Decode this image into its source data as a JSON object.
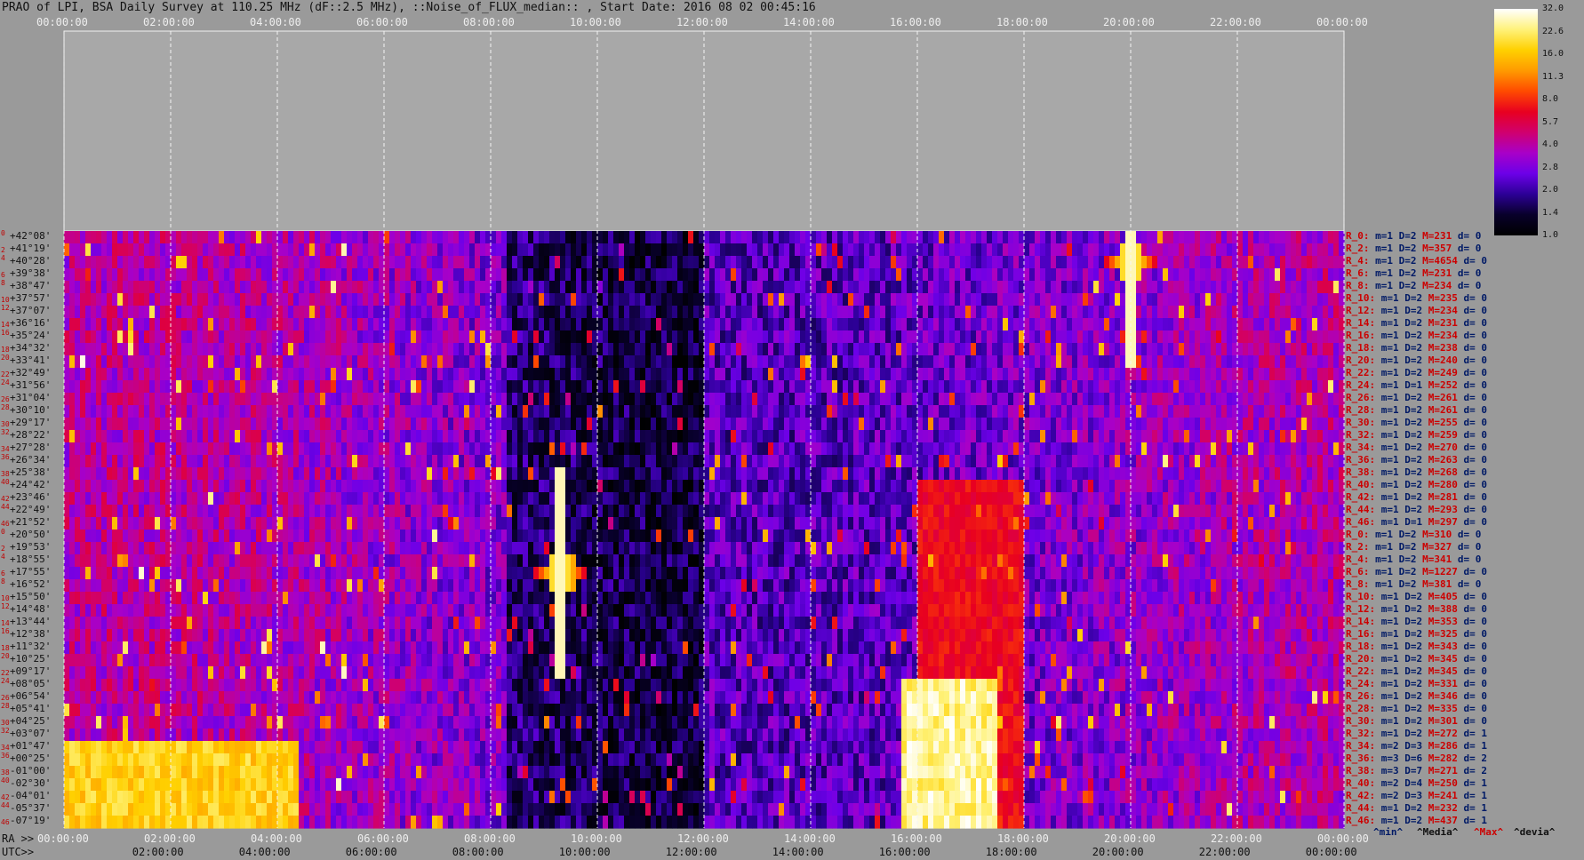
{
  "title": "PRAO of LPI, BSA Daily Survey at 110.25 MHz (dF::2.5 MHz), ::Noise_of_FLUX_median:: , Start Date: 2016 08 02 00:45:16",
  "top_axis_ticks": [
    "00:00:00",
    "02:00:00",
    "04:00:00",
    "06:00:00",
    "08:00:00",
    "10:00:00",
    "12:00:00",
    "14:00:00",
    "16:00:00",
    "18:00:00",
    "20:00:00",
    "22:00:00",
    "00:00:00"
  ],
  "ra_axis_label": "RA >>",
  "ra_axis_ticks": [
    "00:00:00",
    "02:00:00",
    "04:00:00",
    "06:00:00",
    "08:00:00",
    "10:00:00",
    "12:00:00",
    "14:00:00",
    "16:00:00",
    "18:00:00",
    "20:00:00",
    "22:00:00",
    "00:00:00"
  ],
  "utc_axis_label": "UTC>>",
  "utc_axis_ticks": [
    "02:00:00",
    "04:00:00",
    "06:00:00",
    "08:00:00",
    "10:00:00",
    "12:00:00",
    "14:00:00",
    "16:00:00",
    "18:00:00",
    "20:00:00",
    "22:00:00",
    "00:00:00"
  ],
  "row_index_labels": [
    "0",
    "2",
    "4",
    "6",
    "8",
    "10",
    "12",
    "14",
    "16",
    "18",
    "20",
    "22",
    "24",
    "26",
    "28",
    "30",
    "32",
    "34",
    "36",
    "38",
    "40",
    "42",
    "44",
    "46",
    "0",
    "2",
    "4",
    "6",
    "8",
    "10",
    "12",
    "14",
    "16",
    "18",
    "20",
    "22",
    "24",
    "26",
    "28",
    "30",
    "32",
    "34",
    "36",
    "38",
    "40",
    "42",
    "44",
    "46"
  ],
  "declinations": [
    "+42°08'",
    "+41°19'",
    "+40°28'",
    "+39°38'",
    "+38°47'",
    "+37°57'",
    "+37°07'",
    "+36°16'",
    "+35°24'",
    "+34°32'",
    "+33°41'",
    "+32°49'",
    "+31°56'",
    "+31°04'",
    "+30°10'",
    "+29°17'",
    "+28°22'",
    "+27°28'",
    "+26°34'",
    "+25°38'",
    "+24°42'",
    "+23°46'",
    "+22°49'",
    "+21°52'",
    "+20°50'",
    "+19°53'",
    "+18°55'",
    "+17°55'",
    "+16°52'",
    "+15°50'",
    "+14°48'",
    "+13°44'",
    "+12°38'",
    "+11°32'",
    "+10°25'",
    "+09°17'",
    "+08°05'",
    "+06°54'",
    "+05°41'",
    "+04°25'",
    "+03°07'",
    "+01°47'",
    "+00°25'",
    "-01°00'",
    "-02°30'",
    "-04°01'",
    "-05°37'",
    "-07°19'"
  ],
  "row_stats": [
    {
      "r": "R_0:",
      "m": "m=1",
      "D": "D=2",
      "M": "M=231",
      "d": "d= 0"
    },
    {
      "r": "R_2:",
      "m": "m=1",
      "D": "D=2",
      "M": "M=357",
      "d": "d= 0"
    },
    {
      "r": "R_4:",
      "m": "m=1",
      "D": "D=2",
      "M": "M=4654",
      "d": "d= 0"
    },
    {
      "r": "R_6:",
      "m": "m=1",
      "D": "D=2",
      "M": "M=231",
      "d": "d= 0"
    },
    {
      "r": "R_8:",
      "m": "m=1",
      "D": "D=2",
      "M": "M=234",
      "d": "d= 0"
    },
    {
      "r": "R_10:",
      "m": "m=1",
      "D": "D=2",
      "M": "M=235",
      "d": "d= 0"
    },
    {
      "r": "R_12:",
      "m": "m=1",
      "D": "D=2",
      "M": "M=234",
      "d": "d= 0"
    },
    {
      "r": "R_14:",
      "m": "m=1",
      "D": "D=2",
      "M": "M=231",
      "d": "d= 0"
    },
    {
      "r": "R_16:",
      "m": "m=1",
      "D": "D=2",
      "M": "M=234",
      "d": "d= 0"
    },
    {
      "r": "R_18:",
      "m": "m=1",
      "D": "D=2",
      "M": "M=238",
      "d": "d= 0"
    },
    {
      "r": "R_20:",
      "m": "m=1",
      "D": "D=2",
      "M": "M=240",
      "d": "d= 0"
    },
    {
      "r": "R_22:",
      "m": "m=1",
      "D": "D=2",
      "M": "M=249",
      "d": "d= 0"
    },
    {
      "r": "R_24:",
      "m": "m=1",
      "D": "D=1",
      "M": "M=252",
      "d": "d= 0"
    },
    {
      "r": "R_26:",
      "m": "m=1",
      "D": "D=2",
      "M": "M=261",
      "d": "d= 0"
    },
    {
      "r": "R_28:",
      "m": "m=1",
      "D": "D=2",
      "M": "M=261",
      "d": "d= 0"
    },
    {
      "r": "R_30:",
      "m": "m=1",
      "D": "D=2",
      "M": "M=255",
      "d": "d= 0"
    },
    {
      "r": "R_32:",
      "m": "m=1",
      "D": "D=2",
      "M": "M=259",
      "d": "d= 0"
    },
    {
      "r": "R_34:",
      "m": "m=1",
      "D": "D=2",
      "M": "M=270",
      "d": "d= 0"
    },
    {
      "r": "R_36:",
      "m": "m=1",
      "D": "D=2",
      "M": "M=263",
      "d": "d= 0"
    },
    {
      "r": "R_38:",
      "m": "m=1",
      "D": "D=2",
      "M": "M=268",
      "d": "d= 0"
    },
    {
      "r": "R_40:",
      "m": "m=1",
      "D": "D=2",
      "M": "M=280",
      "d": "d= 0"
    },
    {
      "r": "R_42:",
      "m": "m=1",
      "D": "D=2",
      "M": "M=281",
      "d": "d= 0"
    },
    {
      "r": "R_44:",
      "m": "m=1",
      "D": "D=2",
      "M": "M=293",
      "d": "d= 0"
    },
    {
      "r": "R_46:",
      "m": "m=1",
      "D": "D=1",
      "M": "M=297",
      "d": "d= 0"
    },
    {
      "r": "R_0:",
      "m": "m=1",
      "D": "D=2",
      "M": "M=310",
      "d": "d= 0"
    },
    {
      "r": "R_2:",
      "m": "m=1",
      "D": "D=2",
      "M": "M=327",
      "d": "d= 0"
    },
    {
      "r": "R_4:",
      "m": "m=1",
      "D": "D=2",
      "M": "M=341",
      "d": "d= 0"
    },
    {
      "r": "R_6:",
      "m": "m=1",
      "D": "D=2",
      "M": "M=1227",
      "d": "d= 0"
    },
    {
      "r": "R_8:",
      "m": "m=1",
      "D": "D=2",
      "M": "M=381",
      "d": "d= 0"
    },
    {
      "r": "R_10:",
      "m": "m=1",
      "D": "D=2",
      "M": "M=405",
      "d": "d= 0"
    },
    {
      "r": "R_12:",
      "m": "m=1",
      "D": "D=2",
      "M": "M=388",
      "d": "d= 0"
    },
    {
      "r": "R_14:",
      "m": "m=1",
      "D": "D=2",
      "M": "M=353",
      "d": "d= 0"
    },
    {
      "r": "R_16:",
      "m": "m=1",
      "D": "D=2",
      "M": "M=325",
      "d": "d= 0"
    },
    {
      "r": "R_18:",
      "m": "m=1",
      "D": "D=2",
      "M": "M=343",
      "d": "d= 0"
    },
    {
      "r": "R_20:",
      "m": "m=1",
      "D": "D=2",
      "M": "M=345",
      "d": "d= 0"
    },
    {
      "r": "R_22:",
      "m": "m=1",
      "D": "D=2",
      "M": "M=345",
      "d": "d= 0"
    },
    {
      "r": "R_24:",
      "m": "m=1",
      "D": "D=2",
      "M": "M=331",
      "d": "d= 0"
    },
    {
      "r": "R_26:",
      "m": "m=1",
      "D": "D=2",
      "M": "M=346",
      "d": "d= 0"
    },
    {
      "r": "R_28:",
      "m": "m=1",
      "D": "D=2",
      "M": "M=335",
      "d": "d= 0"
    },
    {
      "r": "R_30:",
      "m": "m=1",
      "D": "D=2",
      "M": "M=301",
      "d": "d= 0"
    },
    {
      "r": "R_32:",
      "m": "m=1",
      "D": "D=2",
      "M": "M=272",
      "d": "d= 1"
    },
    {
      "r": "R_34:",
      "m": "m=2",
      "D": "D=3",
      "M": "M=286",
      "d": "d= 1"
    },
    {
      "r": "R_36:",
      "m": "m=3",
      "D": "D=6",
      "M": "M=282",
      "d": "d= 2"
    },
    {
      "r": "R_38:",
      "m": "m=3",
      "D": "D=7",
      "M": "M=271",
      "d": "d= 2"
    },
    {
      "r": "R_40:",
      "m": "m=2",
      "D": "D=4",
      "M": "M=250",
      "d": "d= 1"
    },
    {
      "r": "R_42:",
      "m": "m=2",
      "D": "D=3",
      "M": "M=241",
      "d": "d= 1"
    },
    {
      "r": "R_44:",
      "m": "m=1",
      "D": "D=2",
      "M": "M=232",
      "d": "d= 1"
    },
    {
      "r": "R_46:",
      "m": "m=1",
      "D": "D=2",
      "M": "M=437",
      "d": "d= 1"
    }
  ],
  "stats_legend": {
    "min": "^min^",
    "median": "^Media^",
    "max": "^Max^",
    "devia": "^devia^"
  },
  "colorbar": {
    "ticks": [
      "32.0",
      "22.6",
      "16.0",
      "11.3",
      "8.0",
      "5.7",
      "4.0",
      "2.8",
      "2.0",
      "1.4",
      "1.0"
    ],
    "colors": [
      "#ffffff",
      "#fff27a",
      "#ffd000",
      "#ff9a00",
      "#ff4a00",
      "#e80020",
      "#d0006e",
      "#a800c8",
      "#6c00e8",
      "#2c0096",
      "#08002a",
      "#000000"
    ]
  },
  "chart_data": {
    "type": "heatmap",
    "title": "PRAO of LPI, BSA Daily Survey at 110.25 MHz (dF::2.5 MHz), ::Noise_of_FLUX_median:: , Start Date: 2016 08 02 00:45:16",
    "x_axis": "RA / UTC (hh:mm:ss), 00:00:00 to 24:00:00",
    "y_axis": "Declination, +42°08' to -07°19' (48 beams)",
    "value_scale": "log, 1.0 to 32.0",
    "features": [
      {
        "desc": "bright source near RA 20:00",
        "ra_h": 20.0,
        "beam": 2,
        "level": 32
      },
      {
        "desc": "bright source near RA 09:20",
        "ra_h": 9.3,
        "beam": 27,
        "level": 32
      },
      {
        "desc": "strong interference band",
        "ra_h_range": [
          15.7,
          17.5
        ],
        "beams": [
          36,
          47
        ],
        "level": 32
      },
      {
        "desc": "bright low-declination band",
        "ra_h_range": [
          0.0,
          4.4
        ],
        "beams": [
          41,
          47
        ],
        "level": 22
      },
      {
        "desc": "enhanced emission band",
        "ra_h_range": [
          16.0,
          18.0
        ],
        "beams": [
          20,
          47
        ],
        "level": 8
      }
    ]
  }
}
